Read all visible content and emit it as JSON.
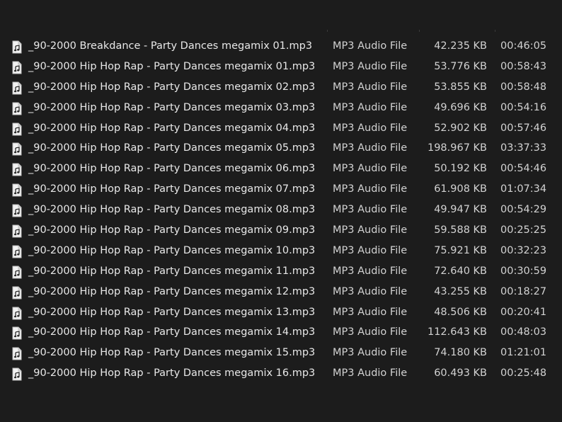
{
  "file_list": {
    "items": [
      {
        "name": "_90-2000 Breakdance - Party Dances megamix 01.mp3",
        "type": "MP3 Audio File",
        "size": "42.235 KB",
        "length": "00:46:05",
        "icon": "audio-file-icon"
      },
      {
        "name": "_90-2000 Hip Hop Rap - Party Dances megamix 01.mp3",
        "type": "MP3 Audio File",
        "size": "53.776 KB",
        "length": "00:58:43",
        "icon": "audio-file-icon"
      },
      {
        "name": "_90-2000 Hip Hop Rap - Party Dances megamix 02.mp3",
        "type": "MP3 Audio File",
        "size": "53.855 KB",
        "length": "00:58:48",
        "icon": "audio-file-icon"
      },
      {
        "name": "_90-2000 Hip Hop Rap - Party Dances megamix 03.mp3",
        "type": "MP3 Audio File",
        "size": "49.696 KB",
        "length": "00:54:16",
        "icon": "audio-file-icon"
      },
      {
        "name": "_90-2000 Hip Hop Rap - Party Dances megamix 04.mp3",
        "type": "MP3 Audio File",
        "size": "52.902 KB",
        "length": "00:57:46",
        "icon": "audio-file-icon"
      },
      {
        "name": "_90-2000 Hip Hop Rap - Party Dances megamix 05.mp3",
        "type": "MP3 Audio File",
        "size": "198.967 KB",
        "length": "03:37:33",
        "icon": "audio-file-icon"
      },
      {
        "name": "_90-2000 Hip Hop Rap - Party Dances megamix 06.mp3",
        "type": "MP3 Audio File",
        "size": "50.192 KB",
        "length": "00:54:46",
        "icon": "audio-file-icon"
      },
      {
        "name": "_90-2000 Hip Hop Rap - Party Dances megamix 07.mp3",
        "type": "MP3 Audio File",
        "size": "61.908 KB",
        "length": "01:07:34",
        "icon": "audio-file-icon"
      },
      {
        "name": "_90-2000 Hip Hop Rap - Party Dances megamix 08.mp3",
        "type": "MP3 Audio File",
        "size": "49.947 KB",
        "length": "00:54:29",
        "icon": "audio-file-icon"
      },
      {
        "name": "_90-2000 Hip Hop Rap - Party Dances megamix 09.mp3",
        "type": "MP3 Audio File",
        "size": "59.588 KB",
        "length": "00:25:25",
        "icon": "audio-file-icon"
      },
      {
        "name": "_90-2000 Hip Hop Rap - Party Dances megamix 10.mp3",
        "type": "MP3 Audio File",
        "size": "75.921 KB",
        "length": "00:32:23",
        "icon": "audio-file-icon"
      },
      {
        "name": "_90-2000 Hip Hop Rap - Party Dances megamix 11.mp3",
        "type": "MP3 Audio File",
        "size": "72.640 KB",
        "length": "00:30:59",
        "icon": "audio-file-icon"
      },
      {
        "name": "_90-2000 Hip Hop Rap - Party Dances megamix 12.mp3",
        "type": "MP3 Audio File",
        "size": "43.255 KB",
        "length": "00:18:27",
        "icon": "audio-file-icon"
      },
      {
        "name": "_90-2000 Hip Hop Rap - Party Dances megamix 13.mp3",
        "type": "MP3 Audio File",
        "size": "48.506 KB",
        "length": "00:20:41",
        "icon": "audio-file-icon"
      },
      {
        "name": "_90-2000 Hip Hop Rap - Party Dances megamix 14.mp3",
        "type": "MP3 Audio File",
        "size": "112.643 KB",
        "length": "00:48:03",
        "icon": "audio-file-icon"
      },
      {
        "name": "_90-2000 Hip Hop Rap - Party Dances megamix 15.mp3",
        "type": "MP3 Audio File",
        "size": "74.180 KB",
        "length": "01:21:01",
        "icon": "audio-file-icon"
      },
      {
        "name": "_90-2000 Hip Hop Rap - Party Dances megamix 16.mp3",
        "type": "MP3 Audio File",
        "size": "60.493 KB",
        "length": "00:25:48",
        "icon": "audio-file-icon"
      }
    ]
  },
  "colors": {
    "background": "#1c1c1c",
    "text": "#e8e8e8",
    "secondary_text": "#d2d2d2"
  }
}
